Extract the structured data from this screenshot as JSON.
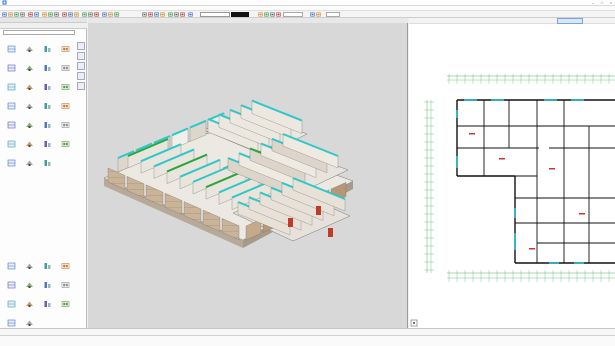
{
  "window": {
    "title": "",
    "minimize_glyph": "–",
    "maximize_glyph": "□",
    "close_glyph": "×"
  },
  "menu": [
    "",
    "",
    "",
    "",
    "",
    "",
    "",
    "",
    "",
    ""
  ],
  "toolbar": {
    "icons": [
      "new-icon",
      "open-icon",
      "save-icon",
      "print-icon",
      "undo-icon",
      "redo-icon",
      "cut-icon",
      "copy-icon",
      "paste-icon",
      "zoom-icon",
      "pan-icon",
      "select-icon",
      "measure-icon",
      "grid-icon",
      "layer-icon",
      "snap-icon",
      "render-icon",
      "3d-icon"
    ],
    "dropdown_value": "",
    "field2_value": "",
    "field3_value": ""
  },
  "left_panel": {
    "title": "",
    "tabs": [
      "",
      "",
      "",
      "",
      "",
      ""
    ],
    "active_tab": 0,
    "search_placeholder": "",
    "section1_label": "",
    "section1_items": [
      {
        "label": "",
        "icon": "column-icon"
      },
      {
        "label": "",
        "icon": "wall-icon"
      },
      {
        "label": "",
        "icon": "beam-icon"
      },
      {
        "label": "",
        "icon": "slab-icon"
      },
      {
        "label": "",
        "icon": "window-icon"
      },
      {
        "label": "",
        "icon": "door-icon"
      },
      {
        "label": "",
        "icon": "room-icon"
      },
      {
        "label": "",
        "icon": "stair-icon"
      },
      {
        "label": "",
        "icon": "roof-icon"
      },
      {
        "label": "",
        "icon": "railing-icon"
      },
      {
        "label": "",
        "icon": "curtain-wall-icon"
      },
      {
        "label": "",
        "icon": "opening-icon"
      },
      {
        "label": "",
        "icon": "ramp-icon"
      },
      {
        "label": "",
        "icon": "parking-icon"
      },
      {
        "label": "",
        "icon": "furniture-icon"
      },
      {
        "label": "",
        "icon": "axis-icon"
      },
      {
        "label": "",
        "icon": "dimension-icon"
      },
      {
        "label": "",
        "icon": "text-icon"
      },
      {
        "label": "",
        "icon": "hatch-icon"
      },
      {
        "label": "",
        "icon": "symbol-icon"
      },
      {
        "label": "",
        "icon": "detail-icon"
      },
      {
        "label": "",
        "icon": "section-icon"
      },
      {
        "label": "",
        "icon": "elevation-icon"
      },
      {
        "label": "",
        "icon": "view-icon"
      },
      {
        "label": "",
        "icon": "schedule-icon"
      },
      {
        "label": "",
        "icon": "sheet-icon"
      },
      {
        "label": "",
        "icon": "export-icon"
      }
    ],
    "section2_label": "",
    "section2_items": [
      {
        "label": "",
        "icon": "group-icon"
      },
      {
        "label": "",
        "icon": "array-icon"
      },
      {
        "label": "",
        "icon": "mirror-icon"
      },
      {
        "label": "",
        "icon": "rotate-icon"
      },
      {
        "label": "",
        "icon": "move-icon"
      },
      {
        "label": "",
        "icon": "copy-element-icon"
      },
      {
        "label": "",
        "icon": "align-icon"
      },
      {
        "label": "",
        "icon": "offset-icon"
      },
      {
        "label": "",
        "icon": "trim-icon"
      },
      {
        "label": "",
        "icon": "split-icon"
      },
      {
        "label": "",
        "icon": "join-icon"
      },
      {
        "label": "",
        "icon": "delete-icon"
      },
      {
        "label": "",
        "icon": "settings-icon"
      },
      {
        "label": "",
        "icon": "help-icon"
      }
    ]
  },
  "view3d": {
    "header": ""
  },
  "view2d": {
    "button_label": ""
  },
  "command_line": {
    "text": ""
  },
  "status": {
    "left": "",
    "right1": "",
    "right2": ""
  },
  "colors": {
    "accent": "#1a55b5",
    "teal_wall": "#2ec8c8",
    "green_door": "#2aa640",
    "plan_line": "#111111",
    "grid_green": "#1fa83c"
  }
}
